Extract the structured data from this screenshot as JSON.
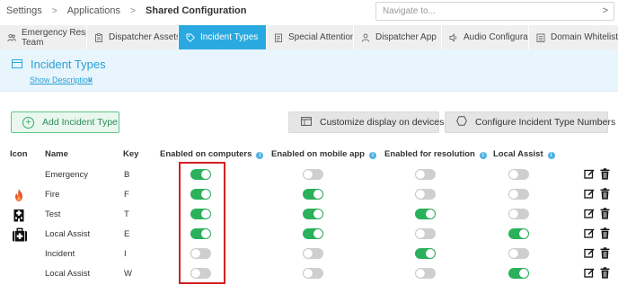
{
  "breadcrumb": {
    "items": [
      "Settings",
      "Applications",
      "Shared Configuration"
    ],
    "separator": ">"
  },
  "navigate": {
    "placeholder": "Navigate to...",
    "chevron": ">"
  },
  "tabs": [
    {
      "label": "Emergency Response Team",
      "line1": "Emergency Response",
      "line2": "Team",
      "icon": "users-icon",
      "active": false
    },
    {
      "label": "Dispatcher Assets",
      "icon": "clipboard-icon",
      "active": false
    },
    {
      "label": "Incident Types",
      "icon": "tag-icon",
      "active": true
    },
    {
      "label": "Special Attentions",
      "icon": "note-icon",
      "active": false
    },
    {
      "label": "Dispatcher App",
      "icon": "user-icon",
      "active": false
    },
    {
      "label": "Audio Configuration",
      "icon": "speaker-icon",
      "active": false
    },
    {
      "label": "Domain Whitelist",
      "icon": "list-icon",
      "active": false
    }
  ],
  "header": {
    "title": "Incident Types",
    "show_description": "Show Description",
    "show_description_chevron": "∨"
  },
  "actions": {
    "add": "Add Incident Type",
    "customize": "Customize display on devices",
    "configure": "Configure Incident Type Numbers"
  },
  "table": {
    "columns": {
      "icon": "Icon",
      "name": "Name",
      "key": "Key",
      "computers": "Enabled on computers",
      "mobile": "Enabled on mobile app",
      "resolution": "Enabled for resolution",
      "local_assist": "Local Assist"
    },
    "rows": [
      {
        "icon": "",
        "name": "Emergency",
        "key": "B",
        "computers": true,
        "mobile": false,
        "resolution": false,
        "local_assist": false
      },
      {
        "icon": "fire-icon",
        "name": "Fire",
        "key": "F",
        "computers": true,
        "mobile": true,
        "resolution": false,
        "local_assist": false
      },
      {
        "icon": "hospital-icon",
        "name": "Test",
        "key": "T",
        "computers": true,
        "mobile": true,
        "resolution": true,
        "local_assist": false
      },
      {
        "icon": "medical-kit-icon",
        "name": "Local Assist",
        "key": "E",
        "computers": true,
        "mobile": true,
        "resolution": false,
        "local_assist": true
      },
      {
        "icon": "",
        "name": "Incident",
        "key": "I",
        "computers": false,
        "mobile": false,
        "resolution": true,
        "local_assist": false
      },
      {
        "icon": "",
        "name": "Local Assist",
        "key": "W",
        "computers": false,
        "mobile": false,
        "resolution": false,
        "local_assist": true
      }
    ]
  },
  "colors": {
    "accent": "#2aa9e0",
    "toggle_on": "#2bb15c",
    "toggle_off": "#cfcfcf",
    "highlight": "#d32020"
  }
}
